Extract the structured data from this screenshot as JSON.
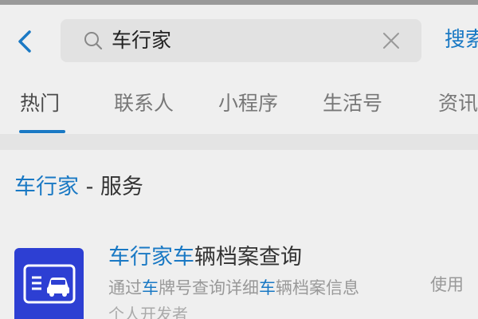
{
  "search": {
    "query": "车行家",
    "button_label": "搜索"
  },
  "tabs": [
    {
      "label": "热门",
      "active": true
    },
    {
      "label": "联系人",
      "active": false
    },
    {
      "label": "小程序",
      "active": false
    },
    {
      "label": "生活号",
      "active": false
    },
    {
      "label": "资讯",
      "active": false
    }
  ],
  "section": {
    "keyword": "车行家",
    "suffix": " - 服务"
  },
  "result": {
    "title_parts": [
      "车行家",
      "车",
      "辆档案查询"
    ],
    "desc_parts": [
      "通过",
      "车",
      "牌号查询详细",
      "车",
      "辆档案信息"
    ],
    "developer": "个人开发者",
    "action_label": "使用"
  },
  "colors": {
    "accent": "#1a79c4",
    "app_icon_bg": "#2d3fd3"
  },
  "icons": {
    "back": "chevron-left-icon",
    "search": "search-icon",
    "clear": "close-icon",
    "app": "car-id-card-icon"
  }
}
